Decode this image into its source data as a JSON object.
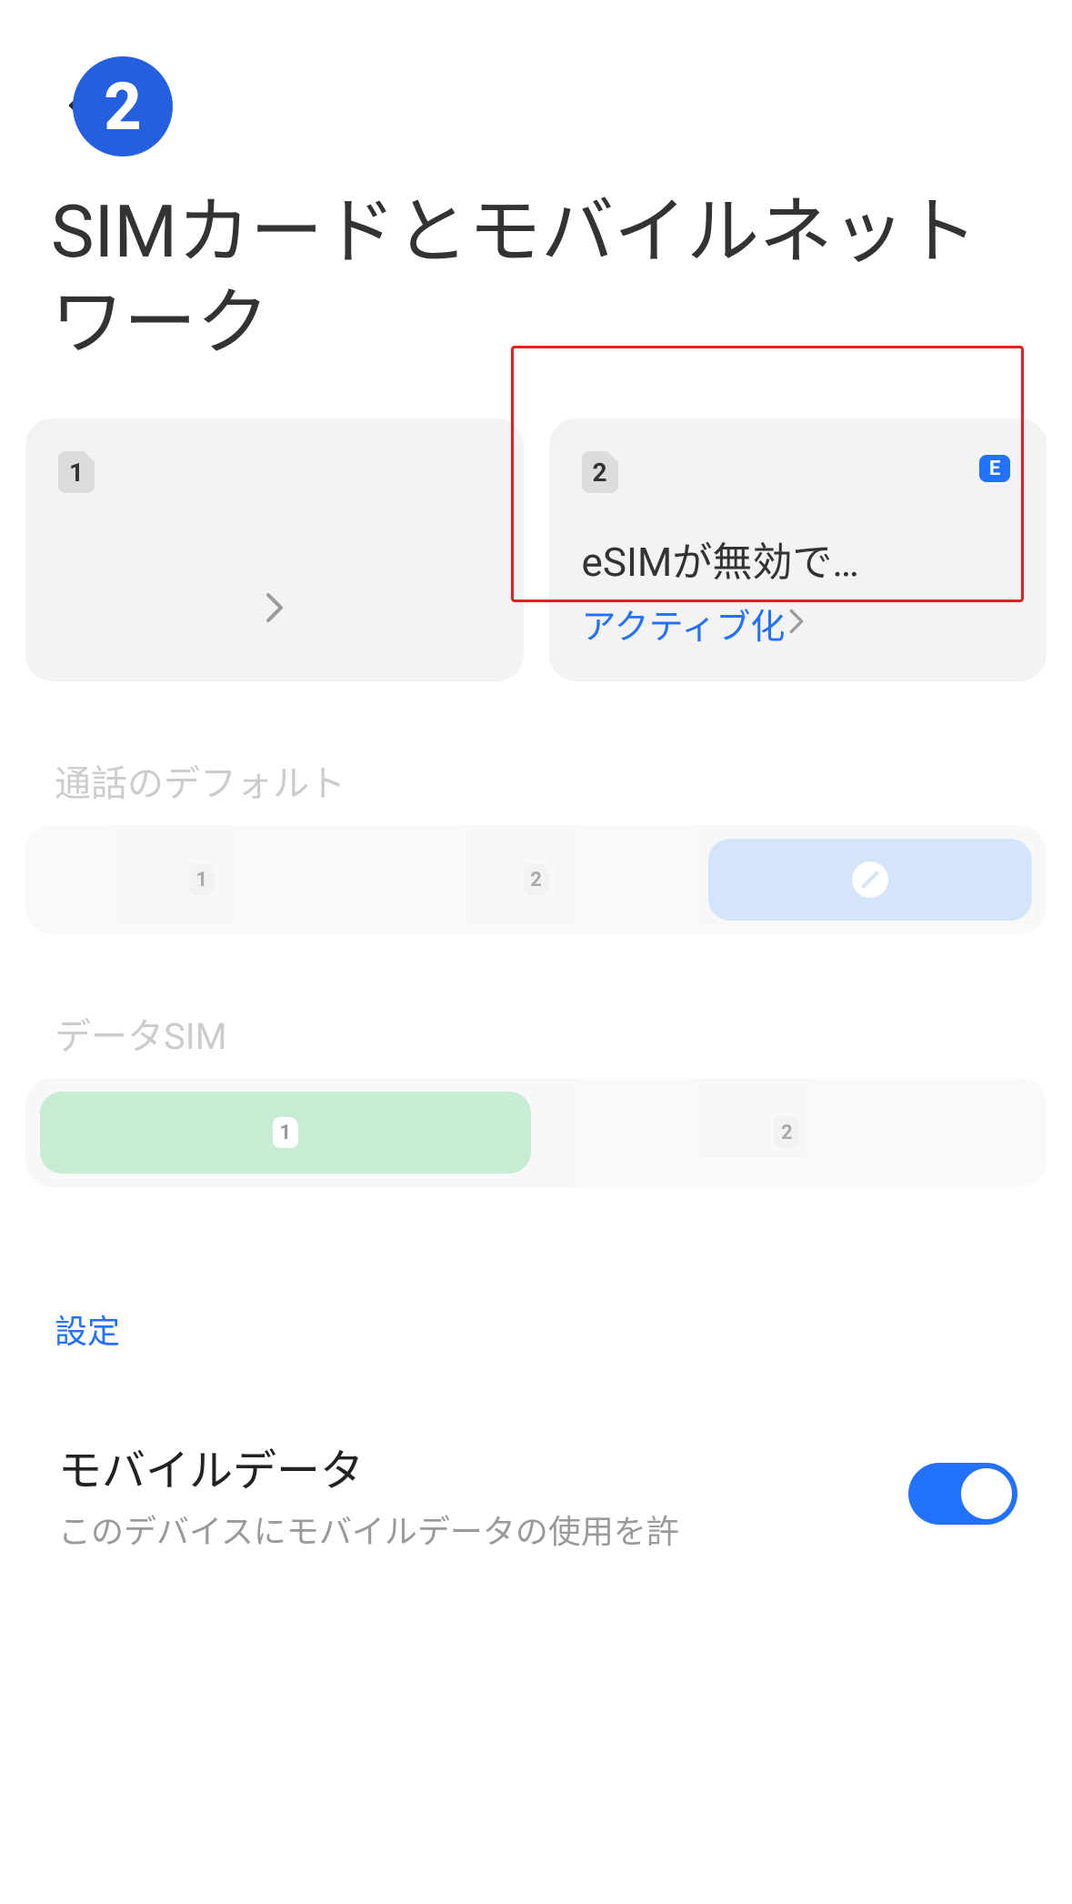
{
  "annotation": {
    "step_number": "2"
  },
  "page": {
    "title": "SIMカードとモバイルネットワーク"
  },
  "sim_cards": {
    "slot1": {
      "slot": "1"
    },
    "slot2": {
      "slot": "2",
      "badge": "E",
      "status_text": "eSIMが無効で…",
      "action_text": "アクティブ化"
    }
  },
  "sections": {
    "call_default": {
      "label": "通話のデフォルト",
      "options": {
        "one": "1",
        "two": "2"
      }
    },
    "data_sim": {
      "label": "データSIM",
      "options": {
        "one": "1",
        "two": "2"
      }
    },
    "settings_label": "設定"
  },
  "settings": {
    "mobile_data": {
      "title": "モバイルデータ",
      "subtitle": "このデバイスにモバイルデータの使用を許"
    }
  }
}
